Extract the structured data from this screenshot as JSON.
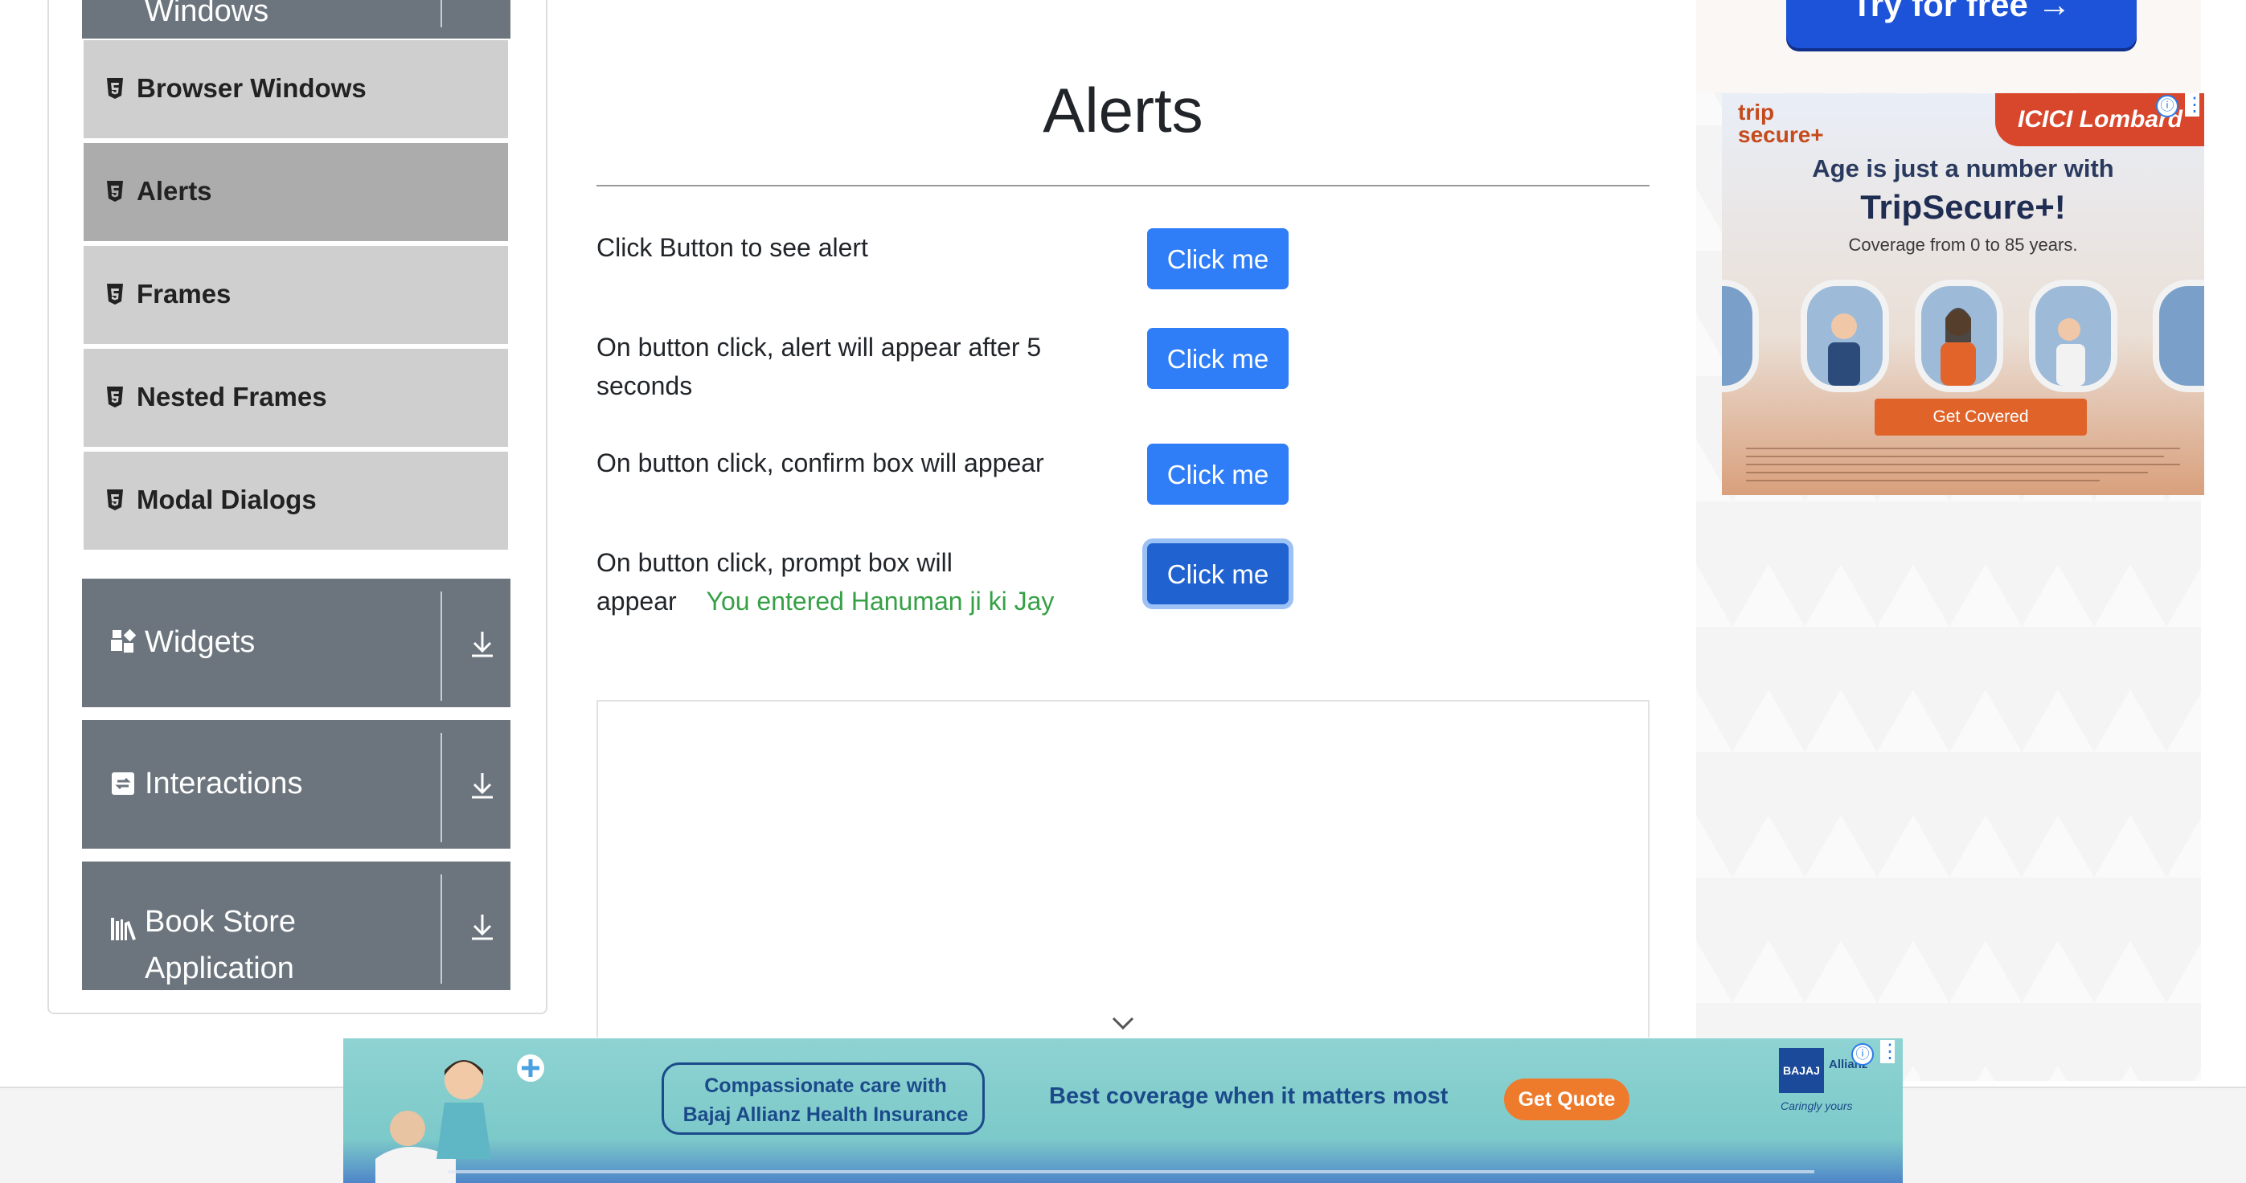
{
  "sidebar": {
    "partial_top_label": "Windows",
    "items": [
      {
        "label": "Browser Windows",
        "active": false
      },
      {
        "label": "Alerts",
        "active": true
      },
      {
        "label": "Frames",
        "active": false
      },
      {
        "label": "Nested Frames",
        "active": false
      },
      {
        "label": "Modal Dialogs",
        "active": false
      }
    ],
    "groups": [
      {
        "label": "Widgets",
        "icon": "widgets-icon"
      },
      {
        "label": "Interactions",
        "icon": "interactions-icon"
      },
      {
        "label": "Book Store",
        "label_line2": "Application",
        "icon": "bookshelf-icon"
      }
    ]
  },
  "main": {
    "title": "Alerts",
    "rows": [
      {
        "label": "Click Button to see alert",
        "button": "Click me"
      },
      {
        "label_line1": "On button click, alert will appear after 5",
        "label_line2": "seconds",
        "button": "Click me"
      },
      {
        "label": "On button click, confirm box will appear",
        "button": "Click me"
      },
      {
        "label_line1": "On button click, prompt box will",
        "label_line2": "appear",
        "result": "You entered Hanuman ji ki Jay",
        "button": "Click me",
        "focused": true
      }
    ]
  },
  "ads": {
    "top_right_button": "Try for free →",
    "icici": {
      "logo_left_line1": "trip",
      "logo_left_line2": "secure+",
      "logo_right": "ICICI Lombard",
      "headline": "Age is just a number with",
      "brand": "TripSecure+!",
      "subtext": "Coverage from 0 to 85 years.",
      "cta": "Get Covered"
    },
    "bajaj": {
      "care_line1": "Compassionate care with",
      "care_line2": "Bajaj Allianz Health Insurance",
      "tagline": "Best coverage when it matters most",
      "cta": "Get Quote",
      "logo": "BAJAJ",
      "partner": "Allianz",
      "logo_tag": "Caringly yours"
    },
    "info_glyph": "ⓘ",
    "menu_glyph": "⋮"
  },
  "colors": {
    "button_blue": "#2f7ef7",
    "sidebar_group": "#6c757d",
    "sidebar_item": "#cfcfcf",
    "sidebar_active": "#acacac",
    "success_green": "#36a046"
  }
}
